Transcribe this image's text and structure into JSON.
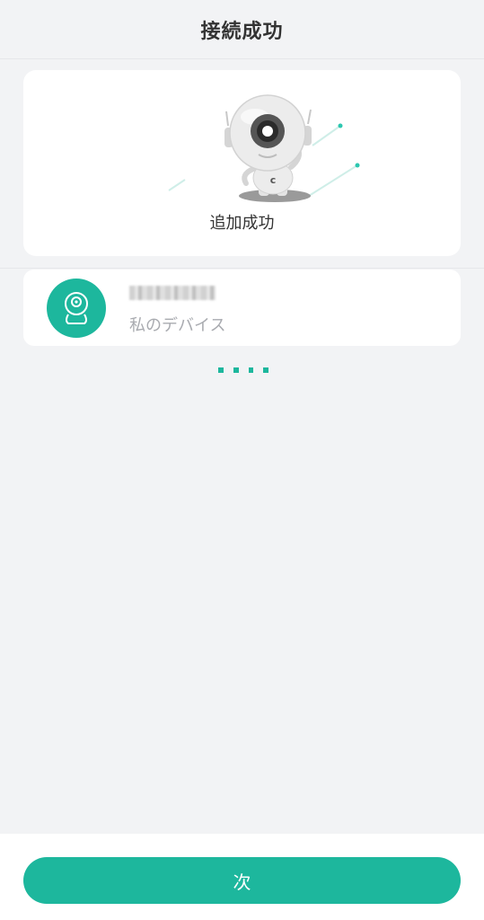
{
  "header": {
    "title": "接続成功"
  },
  "success_card": {
    "message": "追加成功",
    "illustration": "robot-mascot-icon",
    "mascot_badge": "c"
  },
  "device": {
    "icon": "camera-icon",
    "name": "",
    "label": "私のデバイス"
  },
  "footer": {
    "next_label": "次"
  },
  "colors": {
    "accent": "#1db79d",
    "background": "#f2f3f5",
    "card": "#ffffff"
  }
}
